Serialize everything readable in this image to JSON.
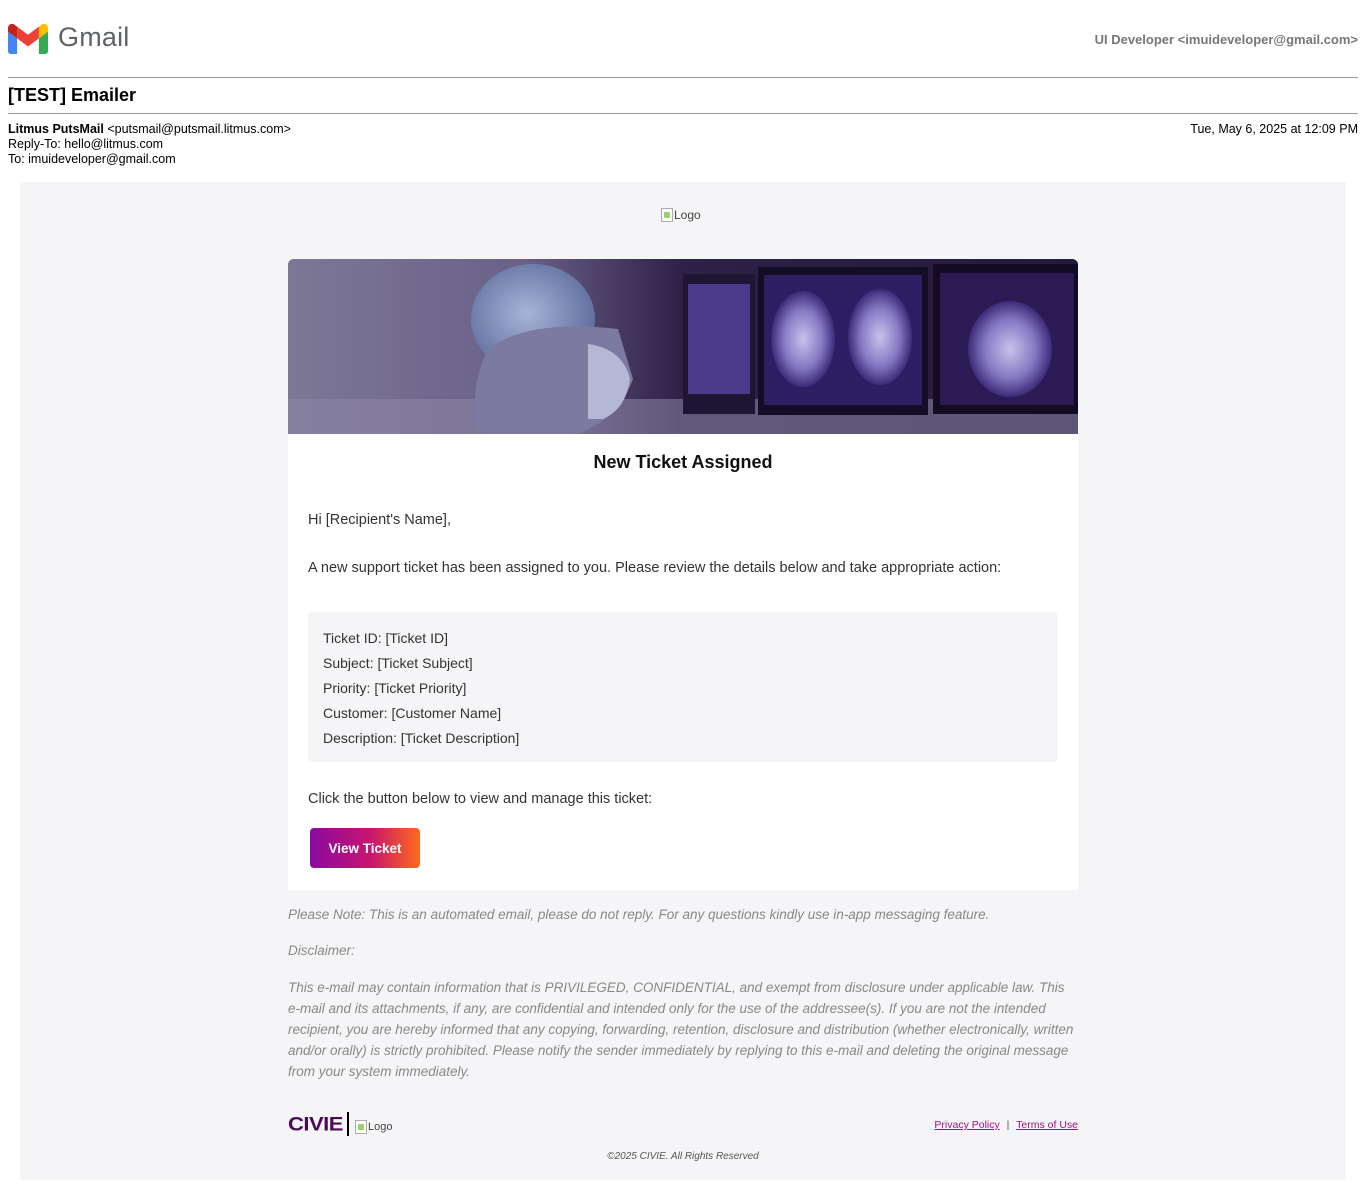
{
  "gmail": {
    "wordmark": "Gmail",
    "account": "UI Developer <imuideveloper@gmail.com>"
  },
  "email": {
    "subject": "[TEST] Emailer",
    "from_name": "Litmus PutsMail",
    "from_address": "<putsmail@putsmail.litmus.com>",
    "reply_to": "Reply-To: hello@litmus.com",
    "to": "To: imuideveloper@gmail.com",
    "date": "Tue, May 6, 2025 at 12:09 PM"
  },
  "body": {
    "top_logo_alt": "Logo",
    "title": "New Ticket Assigned",
    "greeting": "Hi [Recipient's Name],",
    "intro": "A new support ticket has been assigned to you. Please review the details below and take appropriate action:",
    "details": [
      "Ticket ID: [Ticket ID]",
      "Subject: [Ticket Subject]",
      "Priority: [Ticket Priority]",
      "Customer: [Customer Name]",
      "Description: [Ticket Description]"
    ],
    "cta_text": "Click the button below to view and manage this ticket:",
    "button_label": "View Ticket"
  },
  "footer": {
    "note": "Please Note: This is an automated email, please do not reply. For any questions kindly use in-app messaging feature.",
    "disclaimer_label": "Disclaimer:",
    "disclaimer_text": "This e-mail may contain information that is PRIVILEGED, CONFIDENTIAL, and exempt from disclosure under applicable law. This e-mail and its attachments, if any, are confidential and intended only for the use of the addressee(s). If you are not the intended recipient, you are hereby informed that any copying, forwarding, retention, disclosure and distribution (whether electronically, written and/or orally) is strictly prohibited. Please notify the sender immediately by replying to this e-mail and deleting the original message from your system immediately.",
    "brand": "CIVIE",
    "logo_alt": "Logo",
    "privacy_link": "Privacy Policy",
    "link_separator": "|",
    "terms_link": "Terms of Use",
    "copyright": "©2025 CIVIE. All Rights Reserved"
  },
  "colors": {
    "button_gradient_start": "#8a0a9f",
    "button_gradient_end": "#ff6a1a",
    "brand_purple": "#4a0a55",
    "link": "#a0117a"
  }
}
